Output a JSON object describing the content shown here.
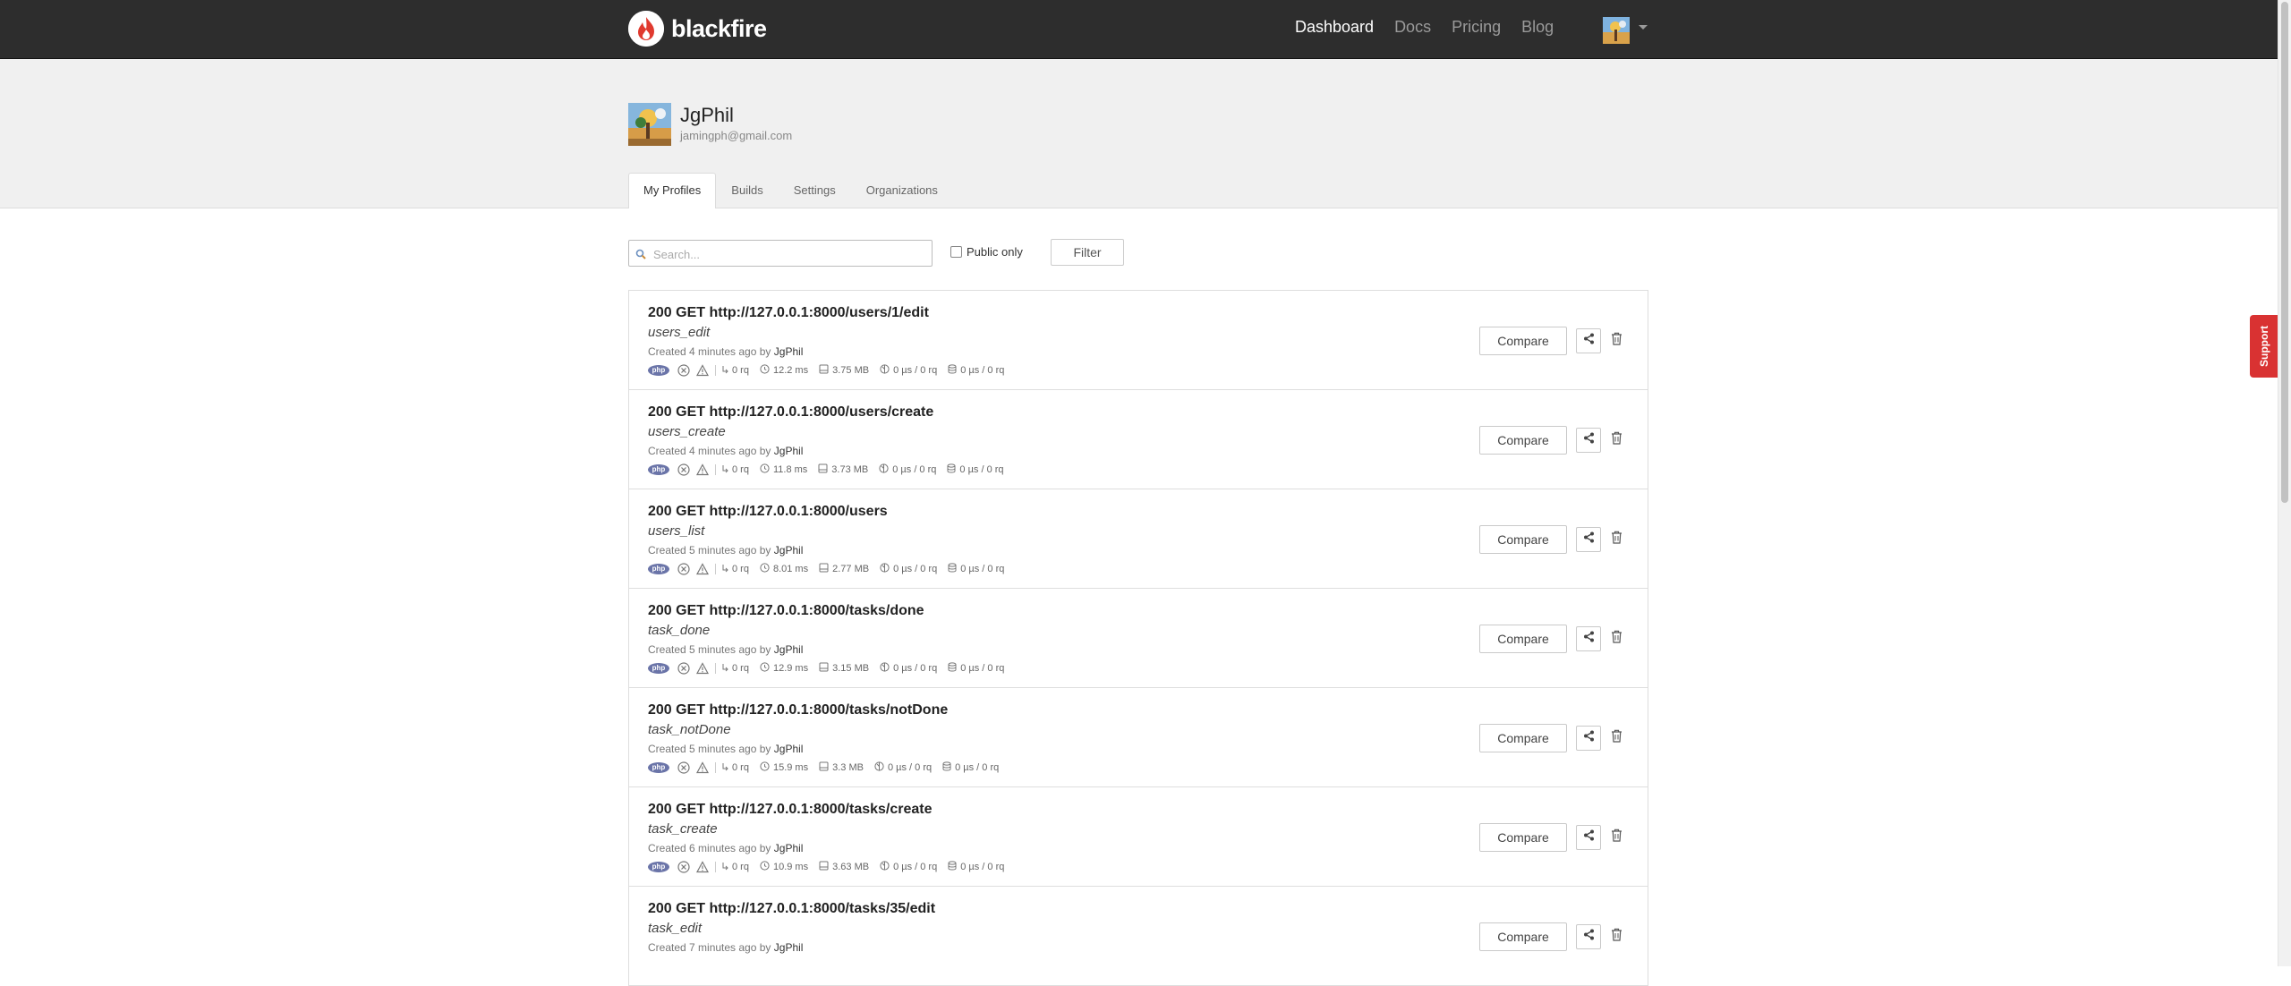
{
  "navbar": {
    "brand": "blackfire",
    "links": [
      {
        "label": "Dashboard",
        "active": true
      },
      {
        "label": "Docs",
        "active": false
      },
      {
        "label": "Pricing",
        "active": false
      },
      {
        "label": "Blog",
        "active": false
      }
    ]
  },
  "user": {
    "name": "JgPhil",
    "email": "jamingph@gmail.com"
  },
  "tabs": [
    {
      "label": "My Profiles",
      "active": true
    },
    {
      "label": "Builds",
      "active": false
    },
    {
      "label": "Settings",
      "active": false
    },
    {
      "label": "Organizations",
      "active": false
    }
  ],
  "filter": {
    "search_placeholder": "Search...",
    "search_value": "",
    "public_only_label": "Public only",
    "public_only_checked": false,
    "filter_label": "Filter"
  },
  "profiles": [
    {
      "title": "200 GET http://127.0.0.1:8000/users/1/edit",
      "route": "users_edit",
      "created": "Created 4 minutes ago by",
      "author": "JgPhil",
      "rq": "0 rq",
      "time": "12.2 ms",
      "memory": "3.75 MB",
      "network": "0 µs / 0 rq",
      "sql": "0 µs / 0 rq"
    },
    {
      "title": "200 GET http://127.0.0.1:8000/users/create",
      "route": "users_create",
      "created": "Created 4 minutes ago by",
      "author": "JgPhil",
      "rq": "0 rq",
      "time": "11.8 ms",
      "memory": "3.73 MB",
      "network": "0 µs / 0 rq",
      "sql": "0 µs / 0 rq"
    },
    {
      "title": "200 GET http://127.0.0.1:8000/users",
      "route": "users_list",
      "created": "Created 5 minutes ago by",
      "author": "JgPhil",
      "rq": "0 rq",
      "time": "8.01 ms",
      "memory": "2.77 MB",
      "network": "0 µs / 0 rq",
      "sql": "0 µs / 0 rq"
    },
    {
      "title": "200 GET http://127.0.0.1:8000/tasks/done",
      "route": "task_done",
      "created": "Created 5 minutes ago by",
      "author": "JgPhil",
      "rq": "0 rq",
      "time": "12.9 ms",
      "memory": "3.15 MB",
      "network": "0 µs / 0 rq",
      "sql": "0 µs / 0 rq"
    },
    {
      "title": "200 GET http://127.0.0.1:8000/tasks/notDone",
      "route": "task_notDone",
      "created": "Created 5 minutes ago by",
      "author": "JgPhil",
      "rq": "0 rq",
      "time": "15.9 ms",
      "memory": "3.3 MB",
      "network": "0 µs / 0 rq",
      "sql": "0 µs / 0 rq"
    },
    {
      "title": "200 GET http://127.0.0.1:8000/tasks/create",
      "route": "task_create",
      "created": "Created 6 minutes ago by",
      "author": "JgPhil",
      "rq": "0 rq",
      "time": "10.9 ms",
      "memory": "3.63 MB",
      "network": "0 µs / 0 rq",
      "sql": "0 µs / 0 rq"
    },
    {
      "title": "200 GET http://127.0.0.1:8000/tasks/35/edit",
      "route": "task_edit",
      "created": "Created 7 minutes ago by",
      "author": "JgPhil",
      "rq": "",
      "time": "",
      "memory": "",
      "network": "",
      "sql": ""
    }
  ],
  "row_actions": {
    "compare_label": "Compare",
    "php_badge": "php"
  },
  "support": {
    "label": "Support"
  },
  "colors": {
    "navbar": "#2d2d2d",
    "header_band": "#f0f0f0",
    "support": "#d93232",
    "php_badge": "#6a74a8"
  }
}
